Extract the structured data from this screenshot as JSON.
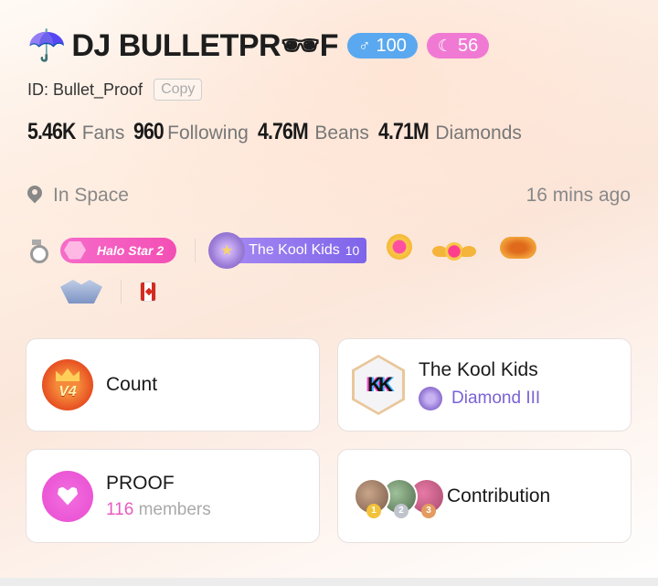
{
  "profile": {
    "umbrella_icon": "☂️",
    "name": "DJ BULLETPR",
    "name_glasses": "🕶",
    "name_end": "F",
    "gender_symbol": "♂",
    "level": "100",
    "moon_symbol": "☾",
    "moon_level": "56",
    "id_text": "ID: Bullet_Proof",
    "copy_label": "Copy"
  },
  "stats": [
    {
      "value": "5.46K",
      "label": "Fans"
    },
    {
      "value": "960",
      "label": "Following"
    },
    {
      "value": "4.76M",
      "label": "Beans"
    },
    {
      "value": "4.71M",
      "label": "Diamonds"
    }
  ],
  "location": {
    "text": "In Space",
    "last_seen": "16 mins ago"
  },
  "badges": {
    "halo": "Halo Star 2",
    "family_name": "The Kool Kids",
    "family_level": "10"
  },
  "cards": {
    "count": {
      "title": "Count",
      "badge": "V4"
    },
    "family": {
      "title": "The Kool Kids",
      "rank": "Diamond III"
    },
    "proof": {
      "title": "PROOF",
      "members_count": "116",
      "members_label": "members"
    },
    "contribution": {
      "title": "Contribution",
      "ranks": [
        "1",
        "2",
        "3"
      ]
    }
  },
  "colors": {
    "gender_badge": "#5aa8ef",
    "moon_badge": "#f07ad3",
    "family_badge": "#7e64ea",
    "halo_badge": "#f34fb5"
  }
}
